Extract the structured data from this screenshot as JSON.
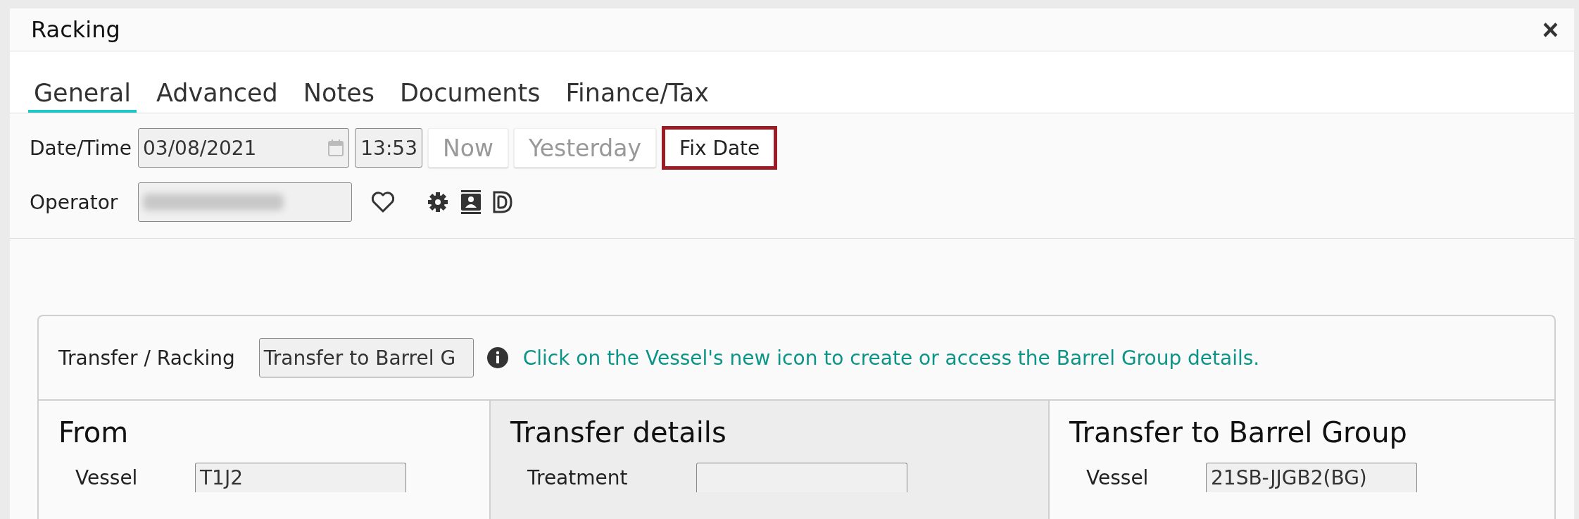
{
  "window": {
    "title": "Racking",
    "close": "×"
  },
  "tabs": [
    {
      "label": "General",
      "selected": true
    },
    {
      "label": "Advanced",
      "selected": false
    },
    {
      "label": "Notes",
      "selected": false
    },
    {
      "label": "Documents",
      "selected": false
    },
    {
      "label": "Finance/Tax",
      "selected": false
    }
  ],
  "date_time": {
    "label": "Date/Time",
    "date": "03/08/2021",
    "time": "13:53",
    "buttons": [
      {
        "label": "Now",
        "highlighted": false
      },
      {
        "label": "Yesterday",
        "highlighted": false
      },
      {
        "label": "Fix Date",
        "highlighted": true
      }
    ]
  },
  "operator": {
    "label": "Operator",
    "redacted": true
  },
  "transfer": {
    "label": "Transfer / Racking",
    "value": "Transfer to Barrel G",
    "hint": "Click on the Vessel's new icon to create or access the Barrel Group details."
  },
  "columns": [
    {
      "heading": "From",
      "shaded": false,
      "field_label": "Vessel",
      "field_value": "T1J2"
    },
    {
      "heading": "Transfer details",
      "shaded": true,
      "field_label": "Treatment"
    },
    {
      "heading": "Transfer to Barrel Group",
      "shaded": false,
      "field_label": "Vessel",
      "field_value": "21SB-JJGB2(BG)"
    }
  ]
}
